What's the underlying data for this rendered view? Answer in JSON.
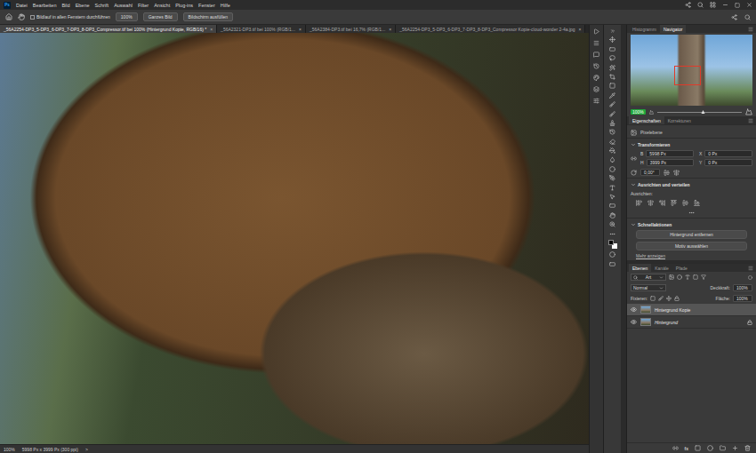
{
  "app": {
    "logo": "Ps"
  },
  "menu": [
    "Datei",
    "Bearbeiten",
    "Bild",
    "Ebene",
    "Schrift",
    "Auswahl",
    "Filter",
    "Ansicht",
    "Plug-ins",
    "Fenster",
    "Hilfe"
  ],
  "options_bar": {
    "scroll_all": {
      "label": "Bildlauf in allen Fenstern durchführen",
      "checked": false
    },
    "buttons": [
      "100%",
      "Ganzes Bild",
      "Bildschirm ausfüllen"
    ]
  },
  "close_glyph": "×",
  "documents": [
    {
      "label": "_56A2254-DP3_5-DP3_6-DP3_7-DP3_8-DP3_Compressor.tif bei 100% (Hintergrund Kopie, RGB/16) *",
      "selected": true
    },
    {
      "label": "_56A2321-DP3.tif bei 100% (RGB/1...",
      "selected": false
    },
    {
      "label": "_56A2384-DP3.tif bei 16,7% (RGB/1...",
      "selected": false
    },
    {
      "label": "_56A2254-DP3_5-DP3_6-DP3_7-DP3_8-DP3_Compressor Kopie-cloud-wonder 2-4a.jpg",
      "selected": false
    }
  ],
  "status_bar": {
    "zoom": "100%",
    "info": "5998 Px x 3999 Px (300 ppi)",
    "arrow": ">"
  },
  "navigator": {
    "tabs": [
      {
        "label": "Histogramm",
        "selected": false
      },
      {
        "label": "Navigator",
        "selected": true
      }
    ],
    "zoom": "100%",
    "level": 0.55
  },
  "properties": {
    "tabs": [
      {
        "label": "Eigenschaften",
        "selected": true
      },
      {
        "label": "Korrekturen",
        "selected": false
      }
    ],
    "layer_kind": "Pixelebene",
    "transform": {
      "title": "Transformieren",
      "fields": [
        {
          "label": "B",
          "value": "5998 Px"
        },
        {
          "label": "X",
          "value": "0 Px"
        },
        {
          "label": "H",
          "value": "3999 Px"
        },
        {
          "label": "Y",
          "value": "0 Px"
        }
      ],
      "angle": "0,00°"
    },
    "align": {
      "title": "Ausrichten und verteilen",
      "label": "Ausrichten:"
    },
    "quick_actions": {
      "title": "Schnellaktionen",
      "buttons": [
        "Hintergrund entfernen",
        "Motiv auswählen"
      ],
      "link": "Mehr anzeigen"
    }
  },
  "layers_panel": {
    "tabs": [
      {
        "label": "Ebenen",
        "selected": true
      },
      {
        "label": "Kanäle",
        "selected": false
      },
      {
        "label": "Pfade",
        "selected": false
      }
    ],
    "filter": "Art",
    "blend": "Normal",
    "opacity_label": "Deckkraft:",
    "opacity": "100%",
    "lock_label": "Fixieren:",
    "fill_label": "Fläche:",
    "fill": "100%",
    "layers": [
      {
        "name": "Hintergrund Kopie",
        "selected": true,
        "visible": true,
        "locked": false
      },
      {
        "name": "Hintergrund",
        "selected": false,
        "visible": true,
        "locked": true
      }
    ],
    "footer_fx": "fx"
  }
}
